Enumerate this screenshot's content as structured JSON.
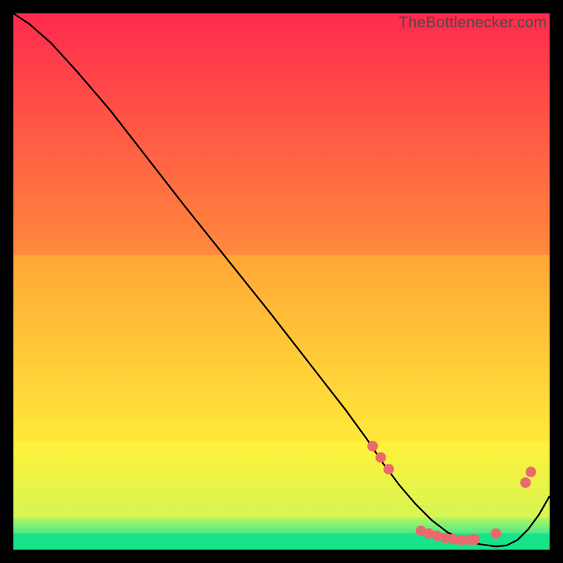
{
  "watermark": "TheBottlenecker.com",
  "colors": {
    "bg": "#000000",
    "curve": "#000000",
    "marker": "#e96a6a",
    "green": "#18e28a",
    "yellow": "#fff13a",
    "orange": "#ffa636",
    "red": "#ff2a4d"
  },
  "chart_data": {
    "type": "line",
    "title": "",
    "xlabel": "",
    "ylabel": "",
    "xlim": [
      0,
      100
    ],
    "ylim": [
      0,
      100
    ],
    "gradient_bands": [
      {
        "y_from": 0,
        "y_to": 3,
        "color_top": "#18e28a",
        "color_bottom": "#18e28a"
      },
      {
        "y_from": 3,
        "y_to": 6,
        "color_top": "#b7f55e",
        "color_bottom": "#4de98a"
      },
      {
        "y_from": 6,
        "y_to": 20,
        "color_top": "#fff13a",
        "color_bottom": "#d8f552"
      },
      {
        "y_from": 20,
        "y_to": 55,
        "color_top": "#ffa636",
        "color_bottom": "#ffe93a"
      },
      {
        "y_from": 55,
        "y_to": 100,
        "color_top": "#ff2a4d",
        "color_bottom": "#ff8a3c"
      }
    ],
    "series": [
      {
        "name": "bottleneck-curve",
        "x": [
          0,
          3,
          7,
          12,
          18,
          25,
          32,
          40,
          48,
          55,
          62,
          66,
          69,
          72,
          75,
          78,
          81,
          84,
          87,
          90,
          92,
          94,
          96,
          98,
          100
        ],
        "y": [
          100,
          98,
          94.5,
          89,
          82,
          73,
          64,
          54,
          44,
          35,
          26,
          20.5,
          16,
          12,
          8.5,
          5.5,
          3.2,
          1.8,
          1.0,
          0.6,
          0.8,
          1.8,
          3.8,
          6.5,
          10
        ]
      }
    ],
    "markers": {
      "name": "highlight-points",
      "points": [
        {
          "x": 67,
          "y": 19.3
        },
        {
          "x": 68.5,
          "y": 17.2
        },
        {
          "x": 70,
          "y": 15
        },
        {
          "x": 76,
          "y": 3.5
        },
        {
          "x": 77.5,
          "y": 3.0
        },
        {
          "x": 79,
          "y": 2.6
        },
        {
          "x": 80.5,
          "y": 2.2
        },
        {
          "x": 82,
          "y": 1.95
        },
        {
          "x": 83.5,
          "y": 1.8
        },
        {
          "x": 85,
          "y": 1.8
        },
        {
          "x": 86,
          "y": 1.9
        },
        {
          "x": 90,
          "y": 3.0
        },
        {
          "x": 95.5,
          "y": 12.5
        },
        {
          "x": 96.5,
          "y": 14.5
        }
      ]
    }
  }
}
